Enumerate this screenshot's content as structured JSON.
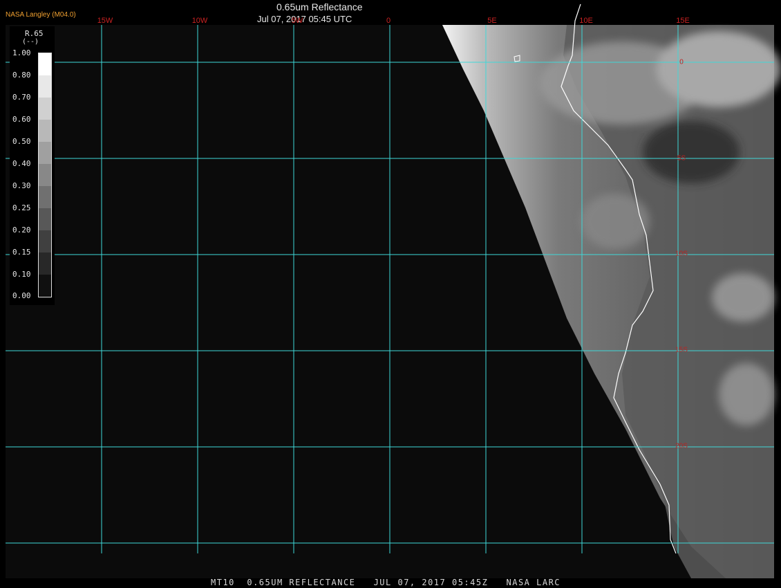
{
  "header": {
    "organization": "NASA Langley (M04.0)",
    "title": "0.65um Reflectance",
    "subtitle": "Jul 07, 2017 05:45 UTC"
  },
  "footer": {
    "caption": "MT10  0.65UM REFLECTANCE   JUL 07, 2017 05:45Z   NASA LARC"
  },
  "legend": {
    "variable": "R.65",
    "unit": "(--)",
    "ticks": [
      "1.00",
      "0.80",
      "0.70",
      "0.60",
      "0.50",
      "0.40",
      "0.30",
      "0.25",
      "0.20",
      "0.15",
      "0.10",
      "0.00"
    ]
  },
  "grid": {
    "longitudes": [
      "15W",
      "10W",
      "5W",
      "0",
      "5E",
      "10E",
      "15E"
    ],
    "latitudes": [
      "0",
      "5S",
      "10S",
      "15S",
      "20S"
    ]
  },
  "colors": {
    "background": "#000000",
    "space": "#0b0b0b",
    "gridline": "#3fd8d8",
    "coastline": "#ffffff",
    "lon_label": "#cc2222",
    "lat_label": "#bb2222",
    "org_label": "#f0a030"
  }
}
